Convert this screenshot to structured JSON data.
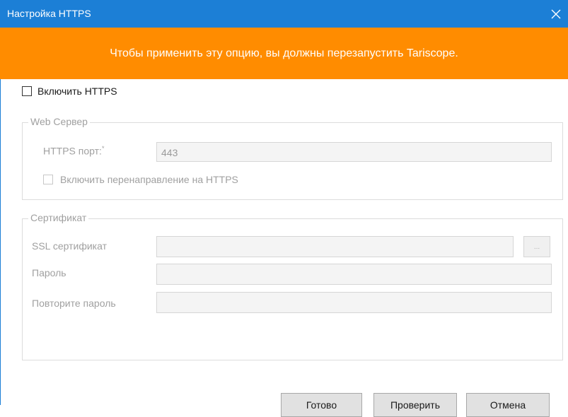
{
  "window": {
    "title": "Настройка HTTPS"
  },
  "banner": {
    "text": "Чтобы применить эту опцию, вы должны перезапустить Tariscope."
  },
  "enable_https": {
    "label": "Включить HTTPS",
    "checked": false
  },
  "web_server": {
    "legend": "Web Сервер",
    "port_label": "HTTPS порт:",
    "required_mark": "*",
    "port_value": "443",
    "redirect_label": "Включить перенаправление на HTTPS"
  },
  "certificate": {
    "legend": "Сертификат",
    "ssl_label": "SSL сертификат",
    "ssl_value": "",
    "browse_label": "...",
    "password_label": "Пароль",
    "repeat_password_label": "Повторите пароль"
  },
  "buttons": {
    "done": "Готово",
    "check": "Проверить",
    "cancel": "Отмена"
  },
  "colors": {
    "titlebar": "#1c7fd6",
    "banner": "#ff8c00"
  }
}
